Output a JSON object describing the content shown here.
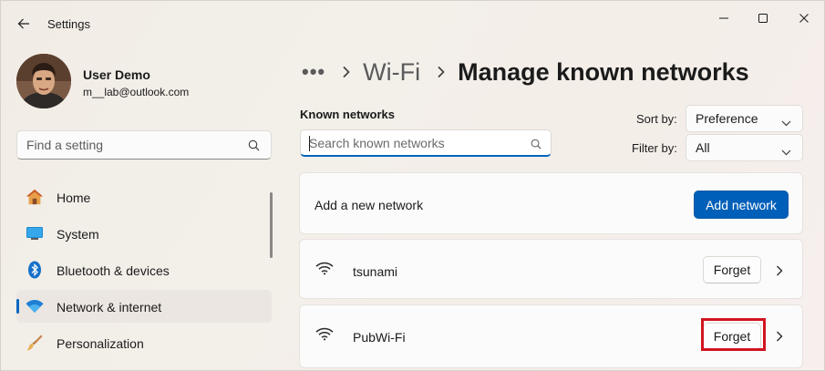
{
  "window": {
    "title": "Settings"
  },
  "user": {
    "name": "User Demo",
    "email": "m__lab@outlook.com"
  },
  "sidebar": {
    "search_placeholder": "Find a setting",
    "items": [
      {
        "label": "Home",
        "icon": "home-icon"
      },
      {
        "label": "System",
        "icon": "system-icon"
      },
      {
        "label": "Bluetooth & devices",
        "icon": "bluetooth-icon"
      },
      {
        "label": "Network & internet",
        "icon": "wifi-icon",
        "active": true
      },
      {
        "label": "Personalization",
        "icon": "brush-icon"
      }
    ]
  },
  "breadcrumb": {
    "more": "•••",
    "parent": "Wi-Fi",
    "current": "Manage known networks"
  },
  "known_networks": {
    "heading": "Known networks",
    "search_placeholder": "Search known networks",
    "sort_label": "Sort by:",
    "sort_value": "Preference",
    "filter_label": "Filter by:",
    "filter_value": "All"
  },
  "add_network": {
    "label": "Add a new network",
    "button": "Add network"
  },
  "networks": [
    {
      "name": "tsunami",
      "forget_label": "Forget"
    },
    {
      "name": "PubWi-Fi",
      "forget_label": "Forget",
      "highlighted": true
    }
  ],
  "colors": {
    "accent": "#005fb8",
    "highlight": "#d1141f"
  }
}
